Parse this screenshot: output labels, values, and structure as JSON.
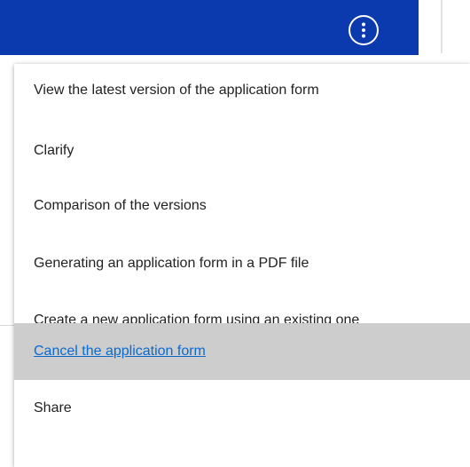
{
  "header": {
    "actions_button_icon": "more-vertical-icon",
    "bar_color": "#0A3AAE"
  },
  "menu": {
    "items": [
      {
        "label": "View the latest version of the application form",
        "highlighted": false
      },
      {
        "label": "Clarify",
        "highlighted": false
      },
      {
        "label": "Comparison of the versions",
        "highlighted": false
      },
      {
        "label": "Generating an application form in a PDF file",
        "highlighted": false
      },
      {
        "label": "Create a new application form using an existing one",
        "highlighted": false
      },
      {
        "label": "Cancel the application form",
        "highlighted": true
      },
      {
        "label": "Share",
        "highlighted": false
      }
    ],
    "highlight_color": "#cdcdcd",
    "link_color": "#0a6ad2"
  }
}
